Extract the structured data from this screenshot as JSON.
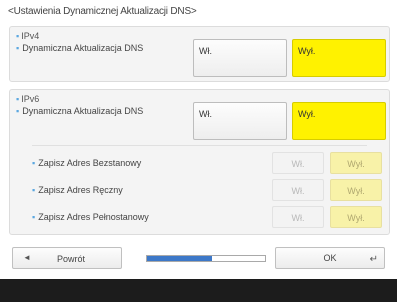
{
  "title": "<Ustawienia Dynamicznej Aktualizacji DNS>",
  "ipv4": {
    "section": "IPv4",
    "row_label": "Dynamiczna Aktualizacja DNS",
    "on_label": "Wł.",
    "off_label": "Wył."
  },
  "ipv6": {
    "section": "IPv6",
    "row_label": "Dynamiczna Aktualizacja DNS",
    "on_label": "Wł.",
    "off_label": "Wył.",
    "subrows": [
      {
        "label": "Zapisz Adres Bezstanowy",
        "on_label": "Wł.",
        "off_label": "Wył."
      },
      {
        "label": "Zapisz Adres Ręczny",
        "on_label": "Wł.",
        "off_label": "Wył."
      },
      {
        "label": "Zapisz Adres Pełnostanowy",
        "on_label": "Wł.",
        "off_label": "Wył."
      }
    ]
  },
  "footer": {
    "back_label": "Powrót",
    "ok_label": "OK",
    "progress": 0.55
  },
  "colors": {
    "selected": "#fff200",
    "accent": "#3d78c8"
  }
}
